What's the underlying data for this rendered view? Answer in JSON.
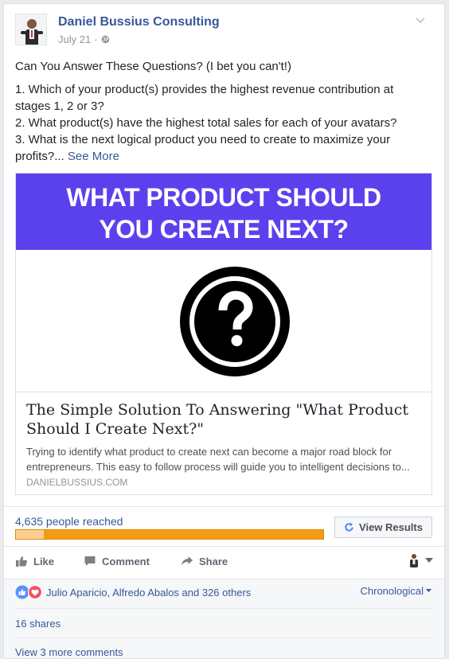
{
  "post": {
    "page_name": "Daniel Bussius Consulting",
    "date": "July 21",
    "separator": "·",
    "privacy_icon": "globe-icon",
    "text_intro": "Can You Answer These Questions? (I bet you can't!)",
    "text_q1": "1. Which of your product(s) provides the highest revenue contribution at stages 1, 2 or 3?",
    "text_q2": "2. What product(s) have the highest total sales for each of your avatars?",
    "text_q3": "3. What is the next logical product you need to create to maximize your profits?...",
    "see_more": "See More"
  },
  "link_preview": {
    "banner_line1": "WHAT PRODUCT SHOULD",
    "banner_line2": "YOU CREATE NEXT?",
    "banner_color": "#5b41ee",
    "image_icon": "question-mark-icon",
    "title": "The Simple Solution To Answering \"What Product Should I Create Next?\"",
    "description": "Trying to identify what product to create next can become a major road block for entrepreneurs. This easy to follow process will guide you to intelligent decisions to...",
    "domain": "DANIELBUSSIUS.COM"
  },
  "insights": {
    "reach_text": "4,635 people reached",
    "organic_fraction": 0.09,
    "view_results_label": "View Results",
    "view_results_icon": "refresh-icon"
  },
  "actions": {
    "like_label": "Like",
    "comment_label": "Comment",
    "share_label": "Share",
    "like_icon": "thumbs-up-icon",
    "comment_icon": "speech-bubble-icon",
    "share_icon": "share-arrow-icon",
    "actor_icon": "avatar-icon"
  },
  "footer": {
    "reactions_text": "Julio Aparicio, Alfredo Abalos and 326 others",
    "reaction_icons": [
      "like-reaction-icon",
      "love-reaction-icon"
    ],
    "sort_label": "Chronological",
    "shares_text": "16 shares",
    "more_comments_text": "View 3 more comments"
  },
  "colors": {
    "link_blue": "#365899",
    "bar_paid": "#f39c12",
    "bar_organic": "#fccf91"
  }
}
